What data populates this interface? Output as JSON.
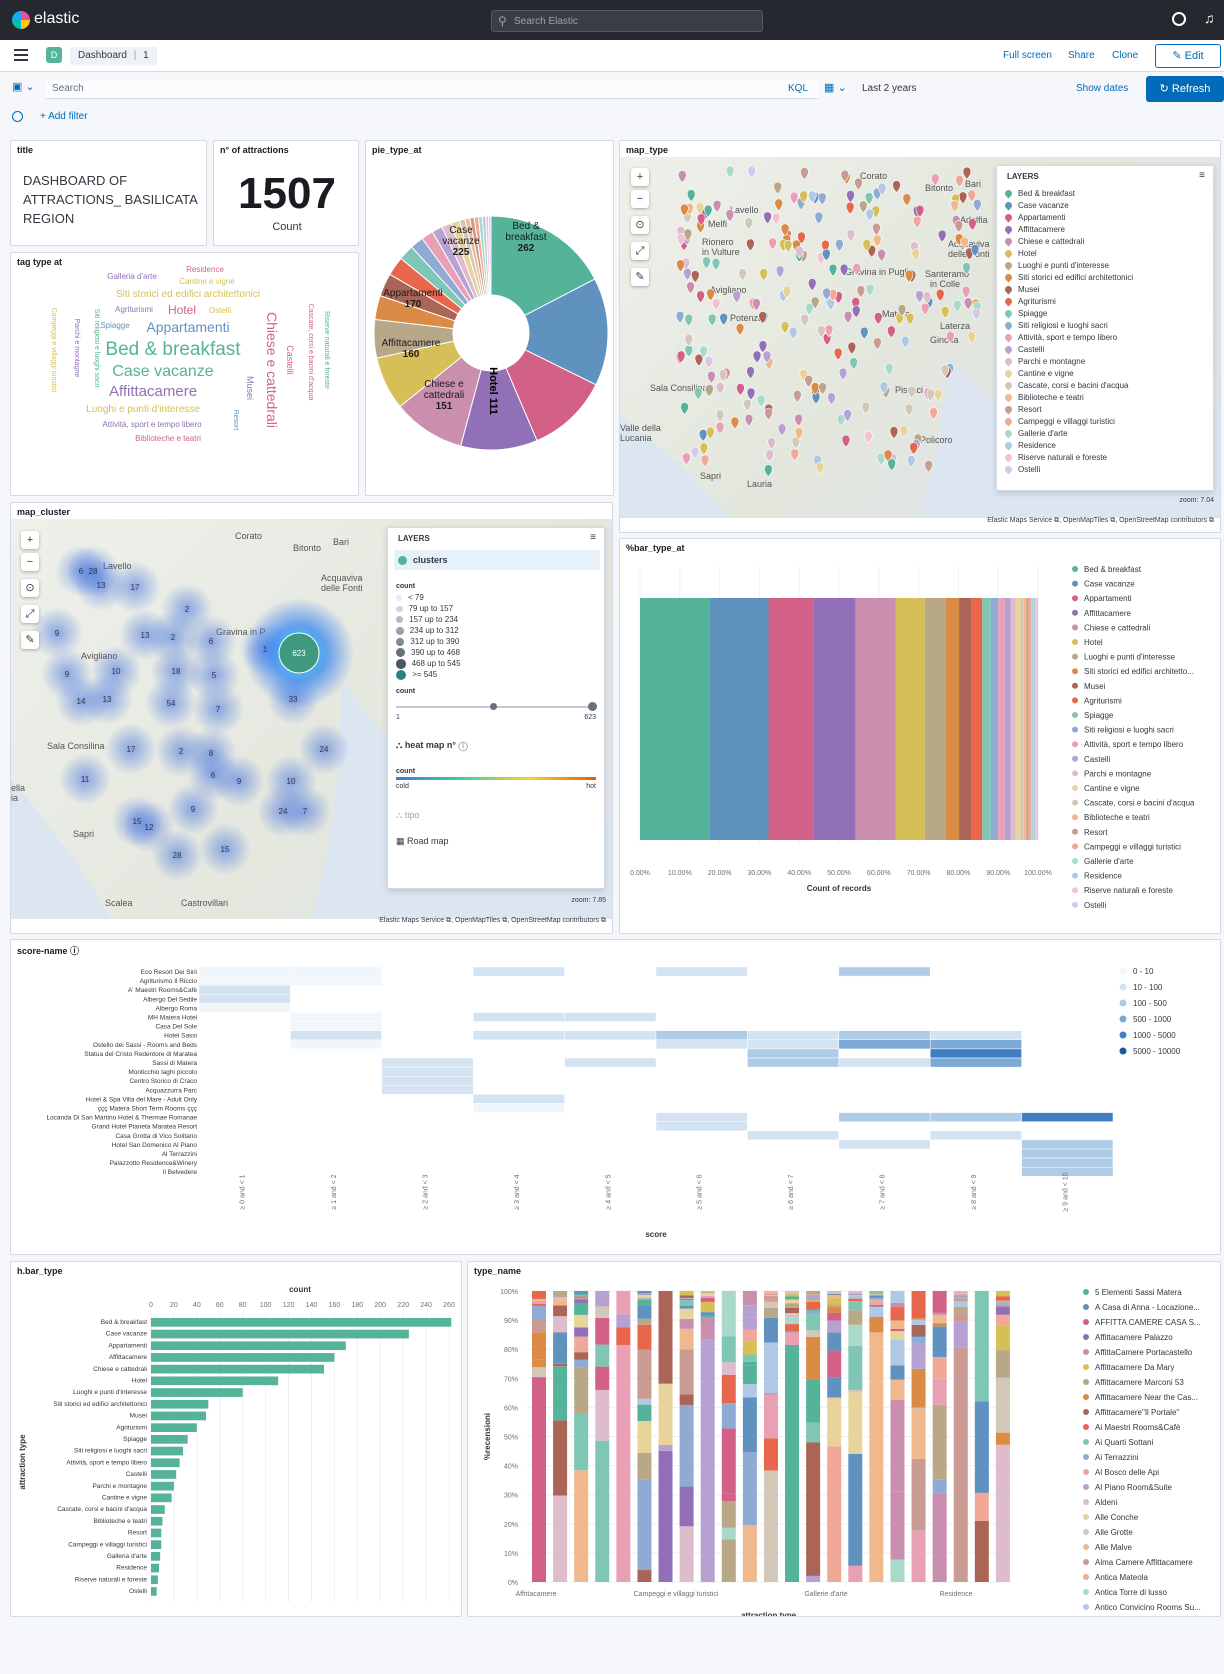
{
  "app": {
    "logo_text": "elastic",
    "search_placeholder": "Search Elastic"
  },
  "header": {
    "space_badge": "D",
    "breadcrumb_root": "Dashboard",
    "breadcrumb_current": "1",
    "full_screen": "Full screen",
    "share": "Share",
    "clone": "Clone",
    "edit": "Edit"
  },
  "query": {
    "placeholder": "Search",
    "language": "KQL",
    "time_range": "Last 2 years",
    "show_dates": "Show dates",
    "refresh": "Refresh",
    "add_filter": "+ Add filter"
  },
  "panels": {
    "title": {
      "title": "title",
      "text": "DASHBOARD OF ATTRACTIONS_ BASILICATA REGION"
    },
    "metric": {
      "title": "n° of attractions",
      "value": "1507",
      "label": "Count"
    },
    "tag": {
      "title": "tag type at"
    },
    "pie": {
      "title": "pie_type_at"
    },
    "map_type": {
      "title": "map_type",
      "zoom": "zoom: 7.04",
      "attribution": "Elastic Maps Service ⧉, OpenMapTiles ⧉, OpenStreetMap contributors ⧉"
    },
    "map_cluster": {
      "title": "map_cluster",
      "zoom": "zoom: 7.85",
      "attribution": "Elastic Maps Service ⧉, OpenMapTiles ⧉, OpenStreetMap contributors ⧉"
    },
    "bar_pct": {
      "title": "%bar_type_at"
    },
    "score": {
      "title": "score-name ⓘ"
    },
    "hbar": {
      "title": "h.bar_type"
    },
    "type_name": {
      "title": "type_name"
    }
  },
  "colors": {
    "accent": "#006bb8",
    "topbar": "#25282f",
    "green": "#54b399"
  },
  "tag_cloud": [
    {
      "t": "Bed & breakfast",
      "c": "#54b399",
      "s": 19,
      "x": 173,
      "y": 355
    },
    {
      "t": "Case vacanze",
      "c": "#54b399",
      "s": 16,
      "x": 163,
      "y": 376
    },
    {
      "t": "Affittacamere",
      "c": "#9170b8",
      "s": 15,
      "x": 153,
      "y": 396
    },
    {
      "t": "Appartamenti",
      "c": "#6092c0",
      "s": 14,
      "x": 188,
      "y": 332
    },
    {
      "t": "Hotel",
      "c": "#d36086",
      "s": 12,
      "x": 182,
      "y": 314
    },
    {
      "t": "Siti storici ed edifici architettonici",
      "c": "#d6bf57",
      "s": 10,
      "x": 188,
      "y": 297
    },
    {
      "t": "Luoghi e punti d'interesse",
      "c": "#d6bf57",
      "s": 10,
      "x": 143,
      "y": 412
    },
    {
      "t": "Attività, sport e tempo libero",
      "c": "#9170b8",
      "s": 8,
      "x": 152,
      "y": 427
    },
    {
      "t": "Biblioteche e teatri",
      "c": "#d36086",
      "s": 8,
      "x": 168,
      "y": 441
    },
    {
      "t": "Agriturismi",
      "c": "#9170b8",
      "s": 8,
      "x": 134,
      "y": 312
    },
    {
      "t": "Spiagge",
      "c": "#6092c0",
      "s": 8,
      "x": 115,
      "y": 328
    },
    {
      "t": "Ostelli",
      "c": "#d6bf57",
      "s": 8,
      "x": 220,
      "y": 313
    },
    {
      "t": "Galleria d'arte",
      "c": "#9170b8",
      "s": 8,
      "x": 132,
      "y": 279
    },
    {
      "t": "Residence",
      "c": "#d36086",
      "s": 8,
      "x": 205,
      "y": 272
    },
    {
      "t": "Cantine e vigne",
      "c": "#d6bf57",
      "s": 8,
      "x": 207,
      "y": 284
    }
  ],
  "tag_cloud_vertical": [
    {
      "t": "Chiese e cattedrali",
      "c": "#d36086",
      "s": 14,
      "x": 267,
      "y": 370
    },
    {
      "t": "Castelli",
      "c": "#d36086",
      "s": 9,
      "x": 287,
      "y": 360
    },
    {
      "t": "Musei",
      "c": "#9170b8",
      "s": 9,
      "x": 247,
      "y": 388
    },
    {
      "t": "Resort",
      "c": "#6092c0",
      "s": 7,
      "x": 234,
      "y": 420
    },
    {
      "t": "Cascate, corsi e bacini d'acqua",
      "c": "#d36086",
      "s": 7,
      "x": 309,
      "y": 352
    },
    {
      "t": "Riserve naturali e foreste",
      "c": "#54b399",
      "s": 7,
      "x": 325,
      "y": 350
    },
    {
      "t": "Siti religiosi e luoghi sacri",
      "c": "#54b399",
      "s": 7,
      "x": 95,
      "y": 348
    },
    {
      "t": "Parchi e montagne",
      "c": "#9170b8",
      "s": 7,
      "x": 75,
      "y": 348
    },
    {
      "t": "Campeggi e villaggi turistici",
      "c": "#d6bf57",
      "s": 7,
      "x": 52,
      "y": 350
    }
  ],
  "attraction_types": [
    {
      "name": "Bed & breakfast",
      "count": 262,
      "color": "#54b399"
    },
    {
      "name": "Case vacanze",
      "count": 225,
      "color": "#6092c0"
    },
    {
      "name": "Appartamenti",
      "count": 170,
      "color": "#d36086"
    },
    {
      "name": "Affittacamere",
      "count": 160,
      "color": "#9170b8"
    },
    {
      "name": "Chiese e cattedrali",
      "count": 151,
      "color": "#ca8eae"
    },
    {
      "name": "Hotel",
      "count": 111,
      "color": "#d6bf57"
    },
    {
      "name": "Luoghi e punti d'interesse",
      "count": 80,
      "color": "#b9a888"
    },
    {
      "name": "Siti storici ed edifici architettonici",
      "count": 50,
      "color": "#da8b45"
    },
    {
      "name": "Musei",
      "count": 48,
      "color": "#aa6556"
    },
    {
      "name": "Agriturismi",
      "count": 40,
      "color": "#e7664c"
    },
    {
      "name": "Spiagge",
      "count": 32,
      "color": "#7fc6b5"
    },
    {
      "name": "Siti religiosi e luoghi sacri",
      "count": 28,
      "color": "#8fabd3"
    },
    {
      "name": "Attività, sport e tempo libero",
      "count": 25,
      "color": "#e9a0b5"
    },
    {
      "name": "Castelli",
      "count": 22,
      "color": "#b7a1d2"
    },
    {
      "name": "Parchi e montagne",
      "count": 20,
      "color": "#ddbccc"
    },
    {
      "name": "Cantine e vigne",
      "count": 18,
      "color": "#e8d49a"
    },
    {
      "name": "Cascate, corsi e bacini d'acqua",
      "count": 12,
      "color": "#d3c8b7"
    },
    {
      "name": "Biblioteche e teatri",
      "count": 10,
      "color": "#efb98d"
    },
    {
      "name": "Resort",
      "count": 9,
      "color": "#c99b92"
    },
    {
      "name": "Campeggi e villaggi turistici",
      "count": 9,
      "color": "#f2a897"
    },
    {
      "name": "Galleria d'arte",
      "count": 8,
      "color": "#a9d9cb"
    },
    {
      "name": "Residence",
      "count": 7,
      "color": "#b0c7e5"
    },
    {
      "name": "Riserve naturali e foreste",
      "count": 6,
      "color": "#f3c2d0"
    },
    {
      "name": "Ostelli",
      "count": 5,
      "color": "#d5c8e8"
    }
  ],
  "pie_labels": [
    {
      "t1": "Bed &",
      "t2": "breakfast",
      "v": "262",
      "ang": 20
    },
    {
      "t1": "Case",
      "t2": "vacanze",
      "v": "225",
      "ang": -28
    },
    {
      "t1": "Appartamenti",
      "t2": "",
      "v": "170",
      "ang": -84
    },
    {
      "t1": "Affittacamere",
      "t2": "",
      "v": "160",
      "ang": -126
    },
    {
      "t1": "Chiese e",
      "t2": "cattedrali",
      "v": "151",
      "ang": -162
    },
    {
      "t1": "Hotel 111",
      "t2": "",
      "v": "",
      "ang": 168
    }
  ],
  "map_type_layers": [
    "Bed & breakfast",
    "Case vacanze",
    "Appartamenti",
    "Affittacamere",
    "Chiese e cattedrali",
    "Hotel",
    "Luoghi e punti d'interesse",
    "Siti storici ed edifici architettonici",
    "Musei",
    "Agriturismi",
    "Spiagge",
    "Siti religiosi e luoghi sacri",
    "Attività, sport e tempo libero",
    "Castelli",
    "Parchi e montagne",
    "Cantine e vigne",
    "Cascate, corsi e bacini d'acqua",
    "Biblioteche e teatri",
    "Resort",
    "Campeggi e villaggi turistici",
    "Gallerie d'arte",
    "Residence",
    "Riserve naturali e foreste",
    "Ostelli"
  ],
  "map_places_type": [
    {
      "t": "Corato",
      "x": 240,
      "y": 12
    },
    {
      "t": "Bitonto",
      "x": 305,
      "y": 24
    },
    {
      "t": "Bari",
      "x": 345,
      "y": 20
    },
    {
      "t": "Lavello",
      "x": 110,
      "y": 46
    },
    {
      "t": "Melfi",
      "x": 88,
      "y": 60
    },
    {
      "t": "Rionero",
      "x": 82,
      "y": 78
    },
    {
      "t": "in Vulture",
      "x": 82,
      "y": 88
    },
    {
      "t": "Adelfia",
      "x": 340,
      "y": 56
    },
    {
      "t": "Acquaviva",
      "x": 328,
      "y": 80
    },
    {
      "t": "delle Fonti",
      "x": 328,
      "y": 90
    },
    {
      "t": "Gravina in Puglia",
      "x": 225,
      "y": 108
    },
    {
      "t": "Santeramo",
      "x": 305,
      "y": 110
    },
    {
      "t": "in Colle",
      "x": 310,
      "y": 120
    },
    {
      "t": "Avigliano",
      "x": 90,
      "y": 126
    },
    {
      "t": "Potenza",
      "x": 110,
      "y": 154
    },
    {
      "t": "Matera",
      "x": 262,
      "y": 150
    },
    {
      "t": "Laterza",
      "x": 320,
      "y": 162
    },
    {
      "t": "Ginosa",
      "x": 310,
      "y": 176
    },
    {
      "t": "Sala Consilina",
      "x": 30,
      "y": 224
    },
    {
      "t": "Pisticci",
      "x": 275,
      "y": 226
    },
    {
      "t": "Policoro",
      "x": 300,
      "y": 276
    },
    {
      "t": "Valle della",
      "x": 0,
      "y": 264
    },
    {
      "t": "Lucania",
      "x": 0,
      "y": 274
    },
    {
      "t": "Sapri",
      "x": 80,
      "y": 312
    },
    {
      "t": "Lauria",
      "x": 127,
      "y": 320
    }
  ],
  "cluster_legend": {
    "layer": "clusters",
    "count_label": "count",
    "ranges": [
      "< 79",
      "79 up to 157",
      "157 up to 234",
      "234 up to 312",
      "312 up to 390",
      "390 up to 468",
      "468 up to 545",
      ">= 545"
    ],
    "slider_label": "count",
    "slider_min": "1",
    "slider_max": "623",
    "heat_layer": "heat map n°",
    "heat_count": "count",
    "cold": "cold",
    "hot": "hot",
    "tipo": "tipo",
    "road": "Road map",
    "layers_title": "LAYERS"
  },
  "cluster_points": [
    {
      "v": "6",
      "x": 70,
      "y": 52
    },
    {
      "v": "28",
      "x": 82,
      "y": 52
    },
    {
      "v": "13",
      "x": 90,
      "y": 66
    },
    {
      "v": "17",
      "x": 124,
      "y": 68
    },
    {
      "v": "2",
      "x": 176,
      "y": 90
    },
    {
      "v": "9",
      "x": 46,
      "y": 114
    },
    {
      "v": "13",
      "x": 134,
      "y": 116
    },
    {
      "v": "2",
      "x": 162,
      "y": 118
    },
    {
      "v": "6",
      "x": 200,
      "y": 122
    },
    {
      "v": "1",
      "x": 254,
      "y": 130
    },
    {
      "v": "9",
      "x": 56,
      "y": 155
    },
    {
      "v": "10",
      "x": 105,
      "y": 152
    },
    {
      "v": "18",
      "x": 165,
      "y": 152
    },
    {
      "v": "5",
      "x": 203,
      "y": 156
    },
    {
      "v": "14",
      "x": 70,
      "y": 182
    },
    {
      "v": "13",
      "x": 96,
      "y": 180
    },
    {
      "v": "54",
      "x": 160,
      "y": 184
    },
    {
      "v": "7",
      "x": 207,
      "y": 190
    },
    {
      "v": "33",
      "x": 282,
      "y": 180
    },
    {
      "v": "17",
      "x": 120,
      "y": 230
    },
    {
      "v": "2",
      "x": 170,
      "y": 232
    },
    {
      "v": "8",
      "x": 200,
      "y": 234
    },
    {
      "v": "6",
      "x": 202,
      "y": 256
    },
    {
      "v": "9",
      "x": 228,
      "y": 262
    },
    {
      "v": "24",
      "x": 313,
      "y": 230
    },
    {
      "v": "10",
      "x": 280,
      "y": 262
    },
    {
      "v": "11",
      "x": 74,
      "y": 260
    },
    {
      "v": "15",
      "x": 126,
      "y": 302
    },
    {
      "v": "12",
      "x": 138,
      "y": 308
    },
    {
      "v": "9",
      "x": 182,
      "y": 290
    },
    {
      "v": "24",
      "x": 272,
      "y": 292
    },
    {
      "v": "7",
      "x": 294,
      "y": 292
    },
    {
      "v": "28",
      "x": 166,
      "y": 336
    },
    {
      "v": "15",
      "x": 214,
      "y": 330
    }
  ],
  "cluster_big": {
    "v": "623"
  },
  "cluster_places": [
    {
      "t": "Corato",
      "x": 224,
      "y": 10
    },
    {
      "t": "Bitonto",
      "x": 282,
      "y": 22
    },
    {
      "t": "Bari",
      "x": 322,
      "y": 16
    },
    {
      "t": "Lavello",
      "x": 92,
      "y": 40
    },
    {
      "t": "Acquaviva",
      "x": 310,
      "y": 52
    },
    {
      "t": "delle Fonti",
      "x": 310,
      "y": 62
    },
    {
      "t": "Gravina in P",
      "x": 205,
      "y": 106
    },
    {
      "t": "Avigliano",
      "x": 70,
      "y": 130
    },
    {
      "t": "Sala Consilina",
      "x": 36,
      "y": 220
    },
    {
      "t": "Sapri",
      "x": 62,
      "y": 308
    },
    {
      "t": "Scalea",
      "x": 94,
      "y": 377
    },
    {
      "t": "Castrovillari",
      "x": 170,
      "y": 377
    },
    {
      "t": "ella",
      "x": 0,
      "y": 262
    },
    {
      "t": "ia",
      "x": 0,
      "y": 272
    }
  ],
  "bar_pct": {
    "xticks": [
      "0.00%",
      "10.00%",
      "20.00%",
      "30.00%",
      "40.00%",
      "50.00%",
      "60.00%",
      "70.00%",
      "80.00%",
      "90.00%",
      "100.00%"
    ],
    "xlabel": "Count of records",
    "legend": [
      "Bed & breakfast",
      "Case vacanze",
      "Appartamenti",
      "Affittacamere",
      "Chiese e cattedrali",
      "Hotel",
      "Luoghi e punti d'interesse",
      "Siti storici ed edifici architetto...",
      "Musei",
      "Agriturismi",
      "Spiagge",
      "Siti religiosi e luoghi sacri",
      "Attività, sport e tempo libero",
      "Castelli",
      "Parchi e montagne",
      "Cantine e vigne",
      "Cascate, corsi e bacini d'acqua",
      "Biblioteche e teatri",
      "Resort",
      "Campeggi e villaggi turistici",
      "Gallerie d'arte",
      "Residence",
      "Riserve naturali e foreste",
      "Ostelli"
    ]
  },
  "heatmap": {
    "rows": [
      "Eco Resort Dei Sirii",
      "Agriturismo Il Riccio",
      "A' Maestri Rooms&Cafè",
      "Albergo Del Sedile",
      "Albergo Roma",
      "MH Matera Hotel",
      "Casa Del Sole",
      "Hotel Sassi",
      "Ostello dei Sassi - Rooms and Beds",
      "Statua del Cristo Redentore di Maratea",
      "Sassi di Matera",
      "Monticchio laghi piccolo",
      "Centro Storico di Craco",
      "Acquazzurra Parc",
      "Hotel & Spa Villa del Mare - Adult Only",
      "ççç Matera Short Term Rooms ççç",
      "Locanda Di San Martino Hotel & Thermae Romanae",
      "Grand Hotel Pianeta Maratea Resort",
      "Casa Grotta di Vico Solitario",
      "Hotel San Domenico Al Piano",
      "Al Terrazzini",
      "Palazzotto Residence&Winery",
      "Il Belvedere"
    ],
    "cols": [
      "≥ 0 and < 1",
      "≥ 1 and < 2",
      "≥ 2 and < 3",
      "≥ 3 and < 4",
      "≥ 4 and < 5",
      "≥ 5 and < 6",
      "≥ 6 and < 7",
      "≥ 7 and < 8",
      "≥ 8 and < 9",
      "≥ 9 and < 10"
    ],
    "xlabel": "score",
    "legend": [
      "0 - 10",
      "10 - 100",
      "100 - 500",
      "500 - 1000",
      "1000 - 5000",
      "5000 - 10000"
    ],
    "legend_colors": [
      "#f1f6fb",
      "#d3e3f2",
      "#aecbe7",
      "#7aaad7",
      "#3f7fc1",
      "#1a5799"
    ],
    "cells": [
      [
        0,
        0,
        0
      ],
      [
        0,
        1,
        0
      ],
      [
        0,
        3,
        1
      ],
      [
        0,
        5,
        1
      ],
      [
        0,
        7,
        2
      ],
      [
        1,
        0,
        0
      ],
      [
        1,
        1,
        0
      ],
      [
        2,
        0,
        1
      ],
      [
        3,
        0,
        1
      ],
      [
        4,
        0,
        0
      ],
      [
        5,
        1,
        0
      ],
      [
        5,
        3,
        1
      ],
      [
        5,
        4,
        1
      ],
      [
        6,
        1,
        0
      ],
      [
        7,
        1,
        1
      ],
      [
        7,
        3,
        1
      ],
      [
        7,
        4,
        1
      ],
      [
        7,
        5,
        2
      ],
      [
        7,
        6,
        1
      ],
      [
        7,
        7,
        2
      ],
      [
        7,
        8,
        1
      ],
      [
        8,
        1,
        0
      ],
      [
        8,
        5,
        1
      ],
      [
        8,
        6,
        1
      ],
      [
        8,
        7,
        3
      ],
      [
        8,
        8,
        3
      ],
      [
        9,
        6,
        2
      ],
      [
        9,
        8,
        4
      ],
      [
        10,
        2,
        1
      ],
      [
        10,
        4,
        1
      ],
      [
        10,
        6,
        2
      ],
      [
        10,
        7,
        1
      ],
      [
        10,
        8,
        3
      ],
      [
        11,
        2,
        1
      ],
      [
        12,
        2,
        1
      ],
      [
        13,
        2,
        1
      ],
      [
        14,
        3,
        1
      ],
      [
        15,
        3,
        0
      ],
      [
        16,
        5,
        1
      ],
      [
        16,
        7,
        2
      ],
      [
        16,
        8,
        2
      ],
      [
        16,
        9,
        4
      ],
      [
        17,
        5,
        1
      ],
      [
        18,
        6,
        1
      ],
      [
        18,
        8,
        1
      ],
      [
        19,
        7,
        1
      ],
      [
        19,
        9,
        2
      ],
      [
        20,
        9,
        2
      ],
      [
        21,
        9,
        2
      ],
      [
        22,
        9,
        2
      ]
    ]
  },
  "hbar": {
    "xlabel": "count",
    "ylabel": "attraction type",
    "xticks": [
      "0",
      "20",
      "40",
      "60",
      "80",
      "100",
      "120",
      "140",
      "160",
      "180",
      "200",
      "220",
      "240",
      "260"
    ],
    "max": 260
  },
  "type_name": {
    "ylabel": "%recensioni",
    "xlabel": "attraction type",
    "yticks": [
      "0%",
      "10%",
      "20%",
      "30%",
      "40%",
      "50%",
      "60%",
      "70%",
      "80%",
      "90%",
      "100%"
    ],
    "xcats": [
      "Affittacamere",
      "Campeggi e villaggi turistici",
      "Gallerie d'arte",
      "Residence"
    ],
    "legend": [
      "5 Elementi Sassi Matera",
      "A Casa di Anna - Locazione...",
      "AFFITTA CAMERE CASA S...",
      "Affittacamere Palazzo",
      "AffittaCamere Portacastello",
      "Affittacamere Da Mary",
      "Affittacamere Marconi 53",
      "Affittacamere Near the Cas...",
      "Affittacamere\"Il Portale\"",
      "Ai Maestri Rooms&Cafè",
      "Ai Quarti Sottani",
      "Ai Terrazzini",
      "Al Bosco delle Api",
      "Al Piano Room&Suite",
      "Aldeni",
      "Alle Conche",
      "Alle Grotte",
      "Alle Malve",
      "Alma Camere Affittacamere",
      "Antica Mateola",
      "Antica Torre di lusso",
      "Antico Convicino Rooms Su..."
    ],
    "legend_colors": [
      "#54b399",
      "#6092c0",
      "#d36086",
      "#9170b8",
      "#ca8eae",
      "#d6bf57",
      "#b9a888",
      "#da8b45",
      "#aa6556",
      "#e7664c",
      "#7fc6b5",
      "#8fabd3",
      "#e9a0b5",
      "#b7a1d2",
      "#ddbccc",
      "#e8d49a",
      "#d3c8b7",
      "#efb98d",
      "#c99b92",
      "#f2a897",
      "#a9d9cb",
      "#b0c7e5"
    ]
  }
}
